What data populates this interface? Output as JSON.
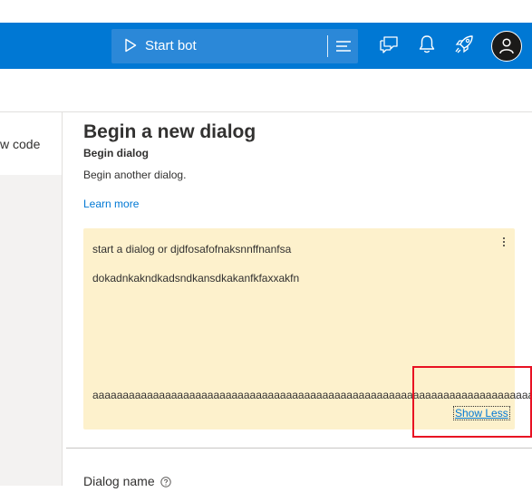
{
  "toolbar": {
    "start_bot_label": "Start bot",
    "icons": [
      "play-icon",
      "menu-icon",
      "chat-icon",
      "bell-icon",
      "rocket-icon",
      "user-avatar-icon"
    ],
    "accent": "#0078d4"
  },
  "left_nav": {
    "item_label": "w code"
  },
  "main": {
    "title": "Begin a new dialog",
    "subtitle": "Begin dialog",
    "description": "Begin another dialog.",
    "learn_more": "Learn more",
    "card": {
      "line1": "start a dialog or djdfosafofnaksnnffnanfsa",
      "line2": "dokadnkakndkadsndkansdkakanfkfaxxakfn",
      "line3": "aaaaaaaaaaaaaaaaaaaaaaaaaaaaaaaaaaaaaaaaaaaaaaaaaaaaaaaaaaaaaaaaaaaaaaaaaaaaaaaaaaaaaaaaaa",
      "show_less": "Show Less",
      "background": "#fdf1cc"
    },
    "dialog_name_label": "Dialog name"
  }
}
